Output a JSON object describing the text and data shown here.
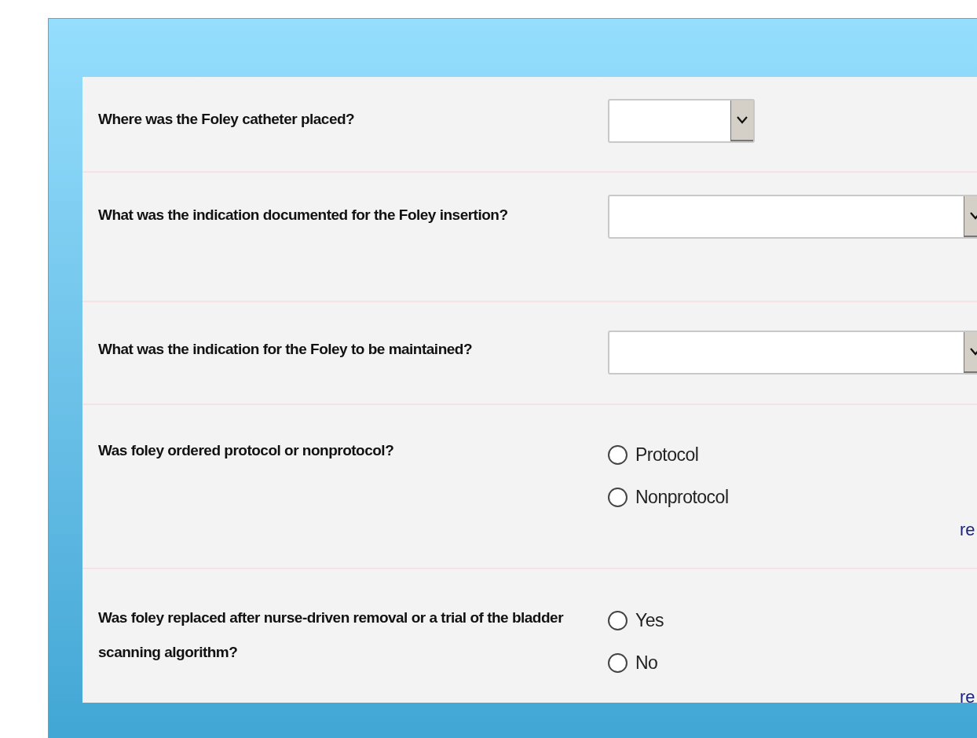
{
  "questions": [
    {
      "kind": "select",
      "question": "Where was the Foley catheter placed?"
    },
    {
      "kind": "select",
      "question": "What was the indication documented for the Foley insertion?"
    },
    {
      "kind": "select",
      "question": "What was the indication for the Foley to be maintained?"
    },
    {
      "kind": "radio",
      "question": "Was foley ordered protocol or nonprotocol?",
      "options": [
        {
          "label": "Protocol",
          "selected": false
        },
        {
          "label": "Nonprotocol",
          "selected": false
        }
      ],
      "reset": "re"
    },
    {
      "kind": "radio",
      "question": "Was foley replaced after nurse-driven removal or a trial of the bladder scanning algorithm?",
      "options": [
        {
          "label": "Yes",
          "selected": false
        },
        {
          "label": "No",
          "selected": false
        }
      ],
      "reset": "re"
    }
  ]
}
